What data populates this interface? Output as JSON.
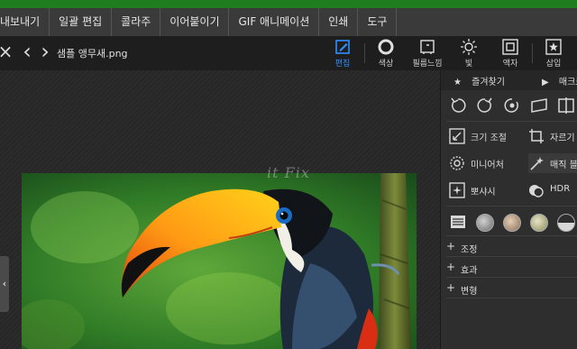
{
  "menu": {
    "items": [
      {
        "label": "내보내기"
      },
      {
        "label": "일괄 편집"
      },
      {
        "label": "콜라주"
      },
      {
        "label": "이어붙이기"
      },
      {
        "label": "GIF 애니메이션"
      },
      {
        "label": "인쇄"
      },
      {
        "label": "도구"
      }
    ]
  },
  "toolbar": {
    "close_icon": "×",
    "prev_icon": "‹",
    "next_icon": "›",
    "filename": "샘플 앵무새.png",
    "tools": [
      {
        "label": "편집",
        "icon": "edit-icon",
        "active": true
      },
      {
        "label": "색상",
        "icon": "color-icon"
      },
      {
        "label": "필름느낌",
        "icon": "film-icon"
      },
      {
        "label": "빛",
        "icon": "light-icon"
      },
      {
        "label": "액자",
        "icon": "frame-icon"
      },
      {
        "label": "삽입",
        "icon": "insert-icon"
      }
    ]
  },
  "canvas": {
    "watermark": "it Fix",
    "left_tab_icon": "‹"
  },
  "panel": {
    "tabs": [
      {
        "label": "즐겨찾기",
        "icon": "★"
      },
      {
        "label": "매크로",
        "icon": "▶"
      }
    ],
    "items": {
      "resize": "크기 조절",
      "crop": "자르기",
      "miniature": "미니어처",
      "magic": "매직 블러",
      "blur": "뽀샤시",
      "hdr": "HDR"
    },
    "accordion": [
      {
        "label": "조정"
      },
      {
        "label": "효과"
      },
      {
        "label": "변형"
      }
    ],
    "accent": "#2f8fff"
  }
}
